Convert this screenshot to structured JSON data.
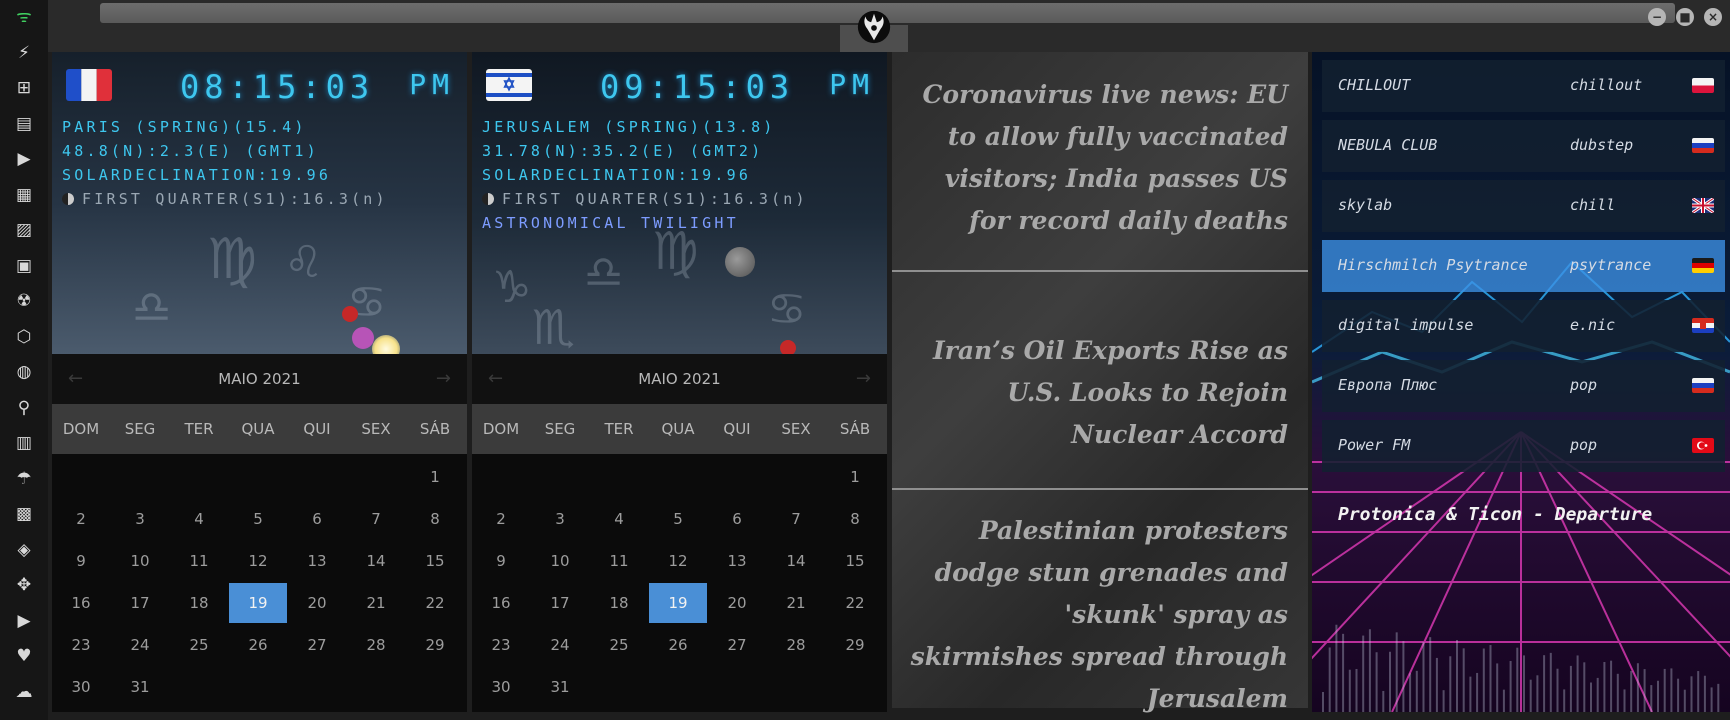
{
  "window": {
    "minimize_label": "−",
    "maximize_label": "■",
    "close_label": "×"
  },
  "sidebar": {
    "items": [
      {
        "name": "wifi-icon",
        "glyph": "ᯤ"
      },
      {
        "name": "lightning-icon",
        "glyph": "⚡"
      },
      {
        "name": "windows-icon",
        "glyph": "⊞"
      },
      {
        "name": "archive-icon",
        "glyph": "▤"
      },
      {
        "name": "play-icon",
        "glyph": "▶"
      },
      {
        "name": "map-book-icon",
        "glyph": "▦"
      },
      {
        "name": "image-icon",
        "glyph": "▨"
      },
      {
        "name": "news-icon",
        "glyph": "▣"
      },
      {
        "name": "radiation-icon",
        "glyph": "☢"
      },
      {
        "name": "hexagon-icon",
        "glyph": "⬡"
      },
      {
        "name": "globe-icon",
        "glyph": "◍"
      },
      {
        "name": "search-icon",
        "glyph": "⚲"
      },
      {
        "name": "map-icon",
        "glyph": "▥"
      },
      {
        "name": "umbrella-icon",
        "glyph": "☂"
      },
      {
        "name": "contact-icon",
        "glyph": "▩"
      },
      {
        "name": "tag-icon",
        "glyph": "◈"
      },
      {
        "name": "expand-icon",
        "glyph": "✥"
      },
      {
        "name": "youtube-icon",
        "glyph": "▶"
      },
      {
        "name": "heart-icon",
        "glyph": "♥"
      },
      {
        "name": "cloud-icon",
        "glyph": "☁"
      }
    ]
  },
  "clocks": [
    {
      "city_line": "PARIS (SPRING)(15.4)",
      "coords_line": "48.8(N):2.3(E) (GMT1)",
      "solar_line": "SOLARDECLINATION:19.96",
      "moon_line": "FIRST QUARTER(S1):16.3(n)",
      "twilight_line": "",
      "time": "08:15:03",
      "ampm": "PM"
    },
    {
      "city_line": "JERUSALEM (SPRING)(13.8)",
      "coords_line": "31.78(N):35.2(E) (GMT2)",
      "solar_line": "SOLARDECLINATION:19.96",
      "moon_line": "FIRST QUARTER(S1):16.3(n)",
      "twilight_line": "ASTRONOMICAL TWILIGHT",
      "time": "09:15:03",
      "ampm": "PM"
    }
  ],
  "calendar": {
    "month_label": "MAIO 2021",
    "weekdays": [
      "DOM",
      "SEG",
      "TER",
      "QUA",
      "QUI",
      "SEX",
      "SÁB"
    ],
    "first_weekday_index": 6,
    "days_in_month": 31,
    "selected_day": 19
  },
  "news": [
    "Coronavirus live news: EU to allow fully vaccinated visitors; India passes US for record daily deaths",
    "Iran’s Oil Exports Rise as U.S. Looks to Rejoin Nuclear Accord",
    "Palestinian protesters dodge stun grenades and 'skunk' spray as skirmishes spread through Jerusalem"
  ],
  "radio": {
    "stations": [
      {
        "name": "CHILLOUT",
        "genre": "chillout",
        "flag": "poland"
      },
      {
        "name": "NEBULA CLUB",
        "genre": "dubstep",
        "flag": "russia"
      },
      {
        "name": "skylab",
        "genre": "chill",
        "flag": "uk"
      },
      {
        "name": "Hirschmilch Psytrance",
        "genre": "psytrance",
        "flag": "germany"
      },
      {
        "name": "digital impulse",
        "genre": "e.nic",
        "flag": "croatia"
      },
      {
        "name": "Европа Плюс",
        "genre": "pop",
        "flag": "russia"
      },
      {
        "name": "Power FM",
        "genre": "pop",
        "flag": "turkey"
      }
    ],
    "active_index": 3,
    "now_playing": "Protonica & Ticon - Departure"
  },
  "colors": {
    "accent_clock": "#3ec7ef",
    "selected_day": "#4a8fd6",
    "twilight": "#7d9cff"
  }
}
